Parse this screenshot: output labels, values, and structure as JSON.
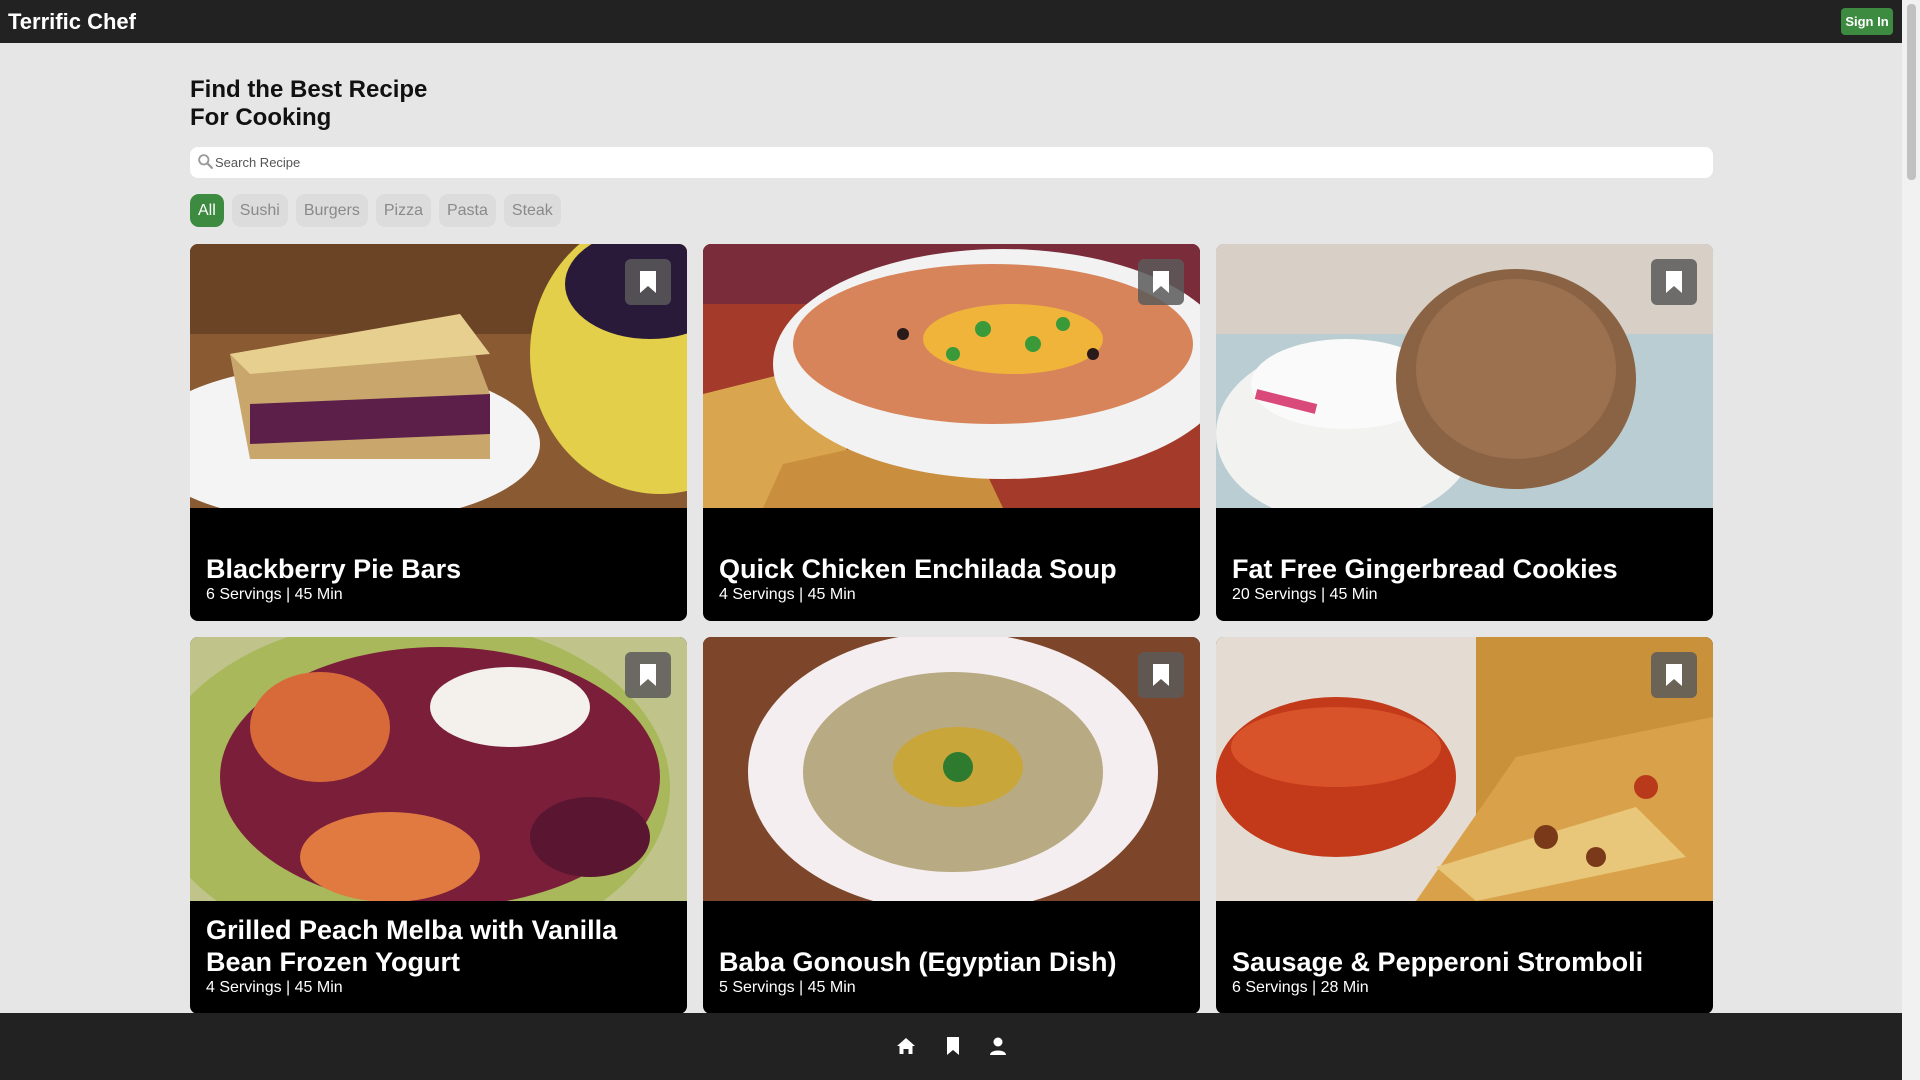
{
  "header": {
    "brand": "Terrific Chef",
    "sign_in_label": "Sign In"
  },
  "hero": {
    "line1": "Find the Best Recipe",
    "line2": "For Cooking"
  },
  "search": {
    "placeholder": "Search Recipe",
    "icon": "search-icon"
  },
  "filters": [
    "All",
    "Sushi",
    "Burgers",
    "Pizza",
    "Pasta",
    "Steak"
  ],
  "active_filter": "All",
  "recipes": [
    {
      "title": "Blackberry Pie Bars",
      "meta": "6 Servings | 45 Min"
    },
    {
      "title": "Quick Chicken Enchilada Soup",
      "meta": "4 Servings | 45 Min"
    },
    {
      "title": "Fat Free Gingerbread Cookies",
      "meta": "20 Servings | 45 Min"
    },
    {
      "title": "Grilled Peach Melba with Vanilla Bean Frozen Yogurt",
      "meta": "4 Servings | 45 Min"
    },
    {
      "title": "Baba Gonoush (Egyptian Dish)",
      "meta": "5 Servings | 45 Min"
    },
    {
      "title": "Sausage & Pepperoni Stromboli",
      "meta": "6 Servings | 28 Min"
    }
  ],
  "bottom_nav": [
    "home-icon",
    "bookmark-icon",
    "user-icon"
  ],
  "colors": {
    "topbar": "#222222",
    "accent": "#3d8b40",
    "page_bg": "#e6e6e6",
    "card_bg": "#000000"
  }
}
